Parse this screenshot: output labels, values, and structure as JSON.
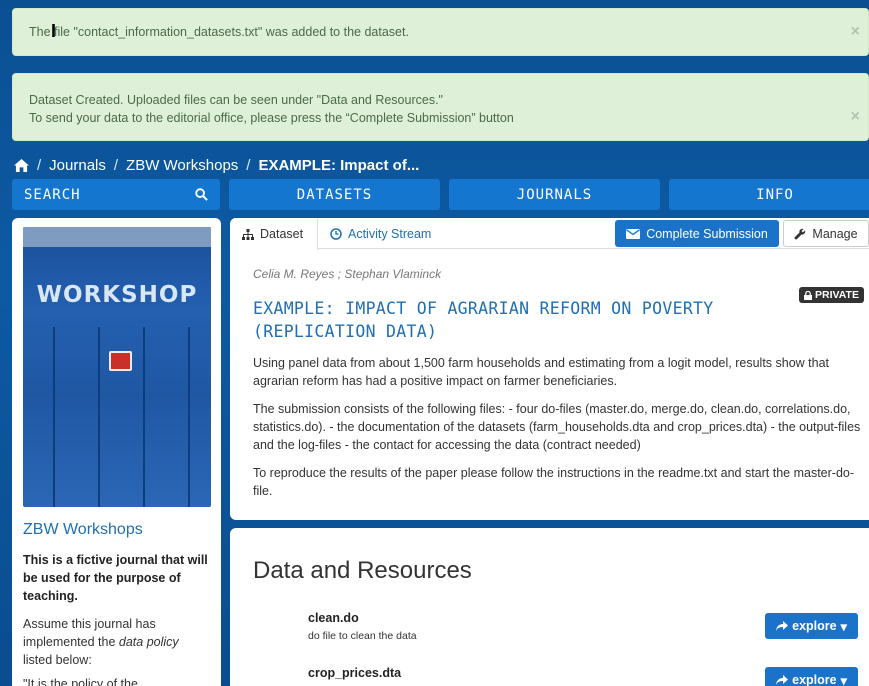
{
  "alerts": [
    {
      "text": "The file \"contact_information_datasets.txt\" was added to the dataset.",
      "close": "×"
    },
    {
      "line1": "Dataset Created. Uploaded files can be seen under \"Data and Resources.\"",
      "line2": "To send your data to the editorial office, please press the “Complete Submission” button",
      "close": "×"
    }
  ],
  "breadcrumb": {
    "sep": "/",
    "items": [
      "Journals",
      "ZBW Workshops"
    ],
    "current": "EXAMPLE: Impact of..."
  },
  "nav": {
    "search": "SEARCH",
    "datasets": "DATASETS",
    "journals": "JOURNALS",
    "info": "INFO"
  },
  "sidebar": {
    "image_text": "WORKSHOP",
    "journal_title": "ZBW Workshops",
    "description": "This is a fictive journal that will be used for the purpose of teaching.",
    "note_prefix": "Assume this journal has implemented the ",
    "note_em": "data policy",
    "note_suffix": " listed below:",
    "quote": "\"It is the policy of the"
  },
  "tabs": {
    "dataset": "Dataset",
    "activity": "Activity Stream"
  },
  "buttons": {
    "complete_submission": "Complete Submission",
    "manage": "Manage"
  },
  "dataset": {
    "authors": "Celia M. Reyes ; Stephan Vlaminck",
    "private": "PRIVATE",
    "title": "EXAMPLE: IMPACT OF AGRARIAN REFORM ON POVERTY (REPLICATION DATA)",
    "notes": [
      "Using panel data from about 1,500 farm households and estimating from a logit model, results show that agrarian reform has had a positive impact on farmer beneficiaries.",
      "The submission consists of the following files: - four do-files (master.do, merge.do, clean.do, correlations.do, statistics.do). - the documentation of the datasets (farm_households.dta and crop_prices.dta) - the output-files and the log-files - the contact for accessing the data (contract needed)",
      "To reproduce the results of the paper please follow the instructions in the readme.txt and start the master-do-file."
    ]
  },
  "resources": {
    "heading": "Data and Resources",
    "explore_label": "explore",
    "items": [
      {
        "name": "clean.do",
        "description": "do file to clean the data"
      },
      {
        "name": "crop_prices.dta",
        "description": ""
      }
    ]
  },
  "colors": {
    "accent": "#1a73c9",
    "link": "#1f6fb2",
    "alert_bg": "#dff0d8",
    "page_bg": "#0b4f93"
  }
}
